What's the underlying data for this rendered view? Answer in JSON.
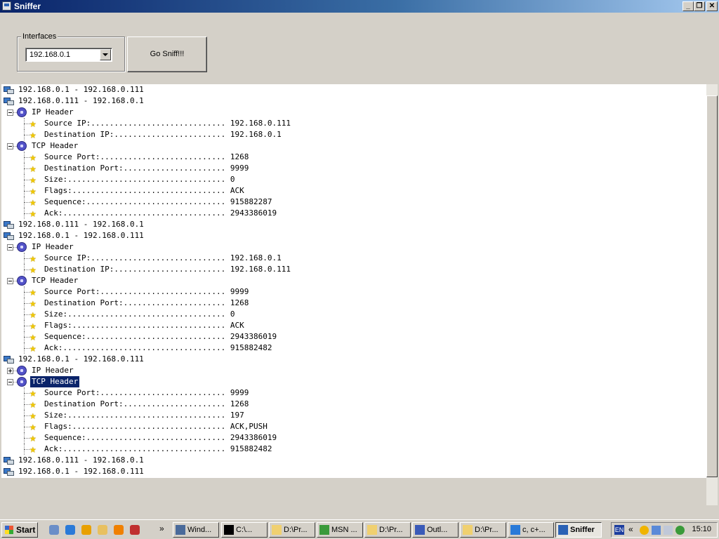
{
  "window": {
    "title": "Sniffer"
  },
  "interfaces": {
    "label": "Interfaces",
    "selected": "192.168.0.1"
  },
  "go_button": "Go Sniff!!!",
  "tree": [
    {
      "level": 0,
      "kind": "host",
      "text": "192.168.0.1 - 192.168.0.111"
    },
    {
      "level": 0,
      "kind": "host",
      "text": "192.168.0.111 - 192.168.0.1"
    },
    {
      "level": 1,
      "kind": "group",
      "exp": "minus",
      "text": "IP Header"
    },
    {
      "level": 2,
      "kind": "field",
      "text": "Source IP:............................. 192.168.0.111"
    },
    {
      "level": 2,
      "kind": "field",
      "text": "Destination IP:........................ 192.168.0.1"
    },
    {
      "level": 1,
      "kind": "group",
      "exp": "minus",
      "text": "TCP Header"
    },
    {
      "level": 2,
      "kind": "field",
      "text": "Source Port:........................... 1268"
    },
    {
      "level": 2,
      "kind": "field",
      "text": "Destination Port:...................... 9999"
    },
    {
      "level": 2,
      "kind": "field",
      "text": "Size:.................................. 0"
    },
    {
      "level": 2,
      "kind": "field",
      "text": "Flags:................................. ACK"
    },
    {
      "level": 2,
      "kind": "field",
      "text": "Sequence:.............................. 915882287"
    },
    {
      "level": 2,
      "kind": "field",
      "text": "Ack:................................... 2943386019"
    },
    {
      "level": 0,
      "kind": "host",
      "text": "192.168.0.111 - 192.168.0.1"
    },
    {
      "level": 0,
      "kind": "host",
      "text": "192.168.0.1 - 192.168.0.111"
    },
    {
      "level": 1,
      "kind": "group",
      "exp": "minus",
      "text": "IP Header"
    },
    {
      "level": 2,
      "kind": "field",
      "text": "Source IP:............................. 192.168.0.1"
    },
    {
      "level": 2,
      "kind": "field",
      "text": "Destination IP:........................ 192.168.0.111"
    },
    {
      "level": 1,
      "kind": "group",
      "exp": "minus",
      "text": "TCP Header"
    },
    {
      "level": 2,
      "kind": "field",
      "text": "Source Port:........................... 9999"
    },
    {
      "level": 2,
      "kind": "field",
      "text": "Destination Port:...................... 1268"
    },
    {
      "level": 2,
      "kind": "field",
      "text": "Size:.................................. 0"
    },
    {
      "level": 2,
      "kind": "field",
      "text": "Flags:................................. ACK"
    },
    {
      "level": 2,
      "kind": "field",
      "text": "Sequence:.............................. 2943386019"
    },
    {
      "level": 2,
      "kind": "field",
      "text": "Ack:................................... 915882482"
    },
    {
      "level": 0,
      "kind": "host",
      "text": "192.168.0.1 - 192.168.0.111"
    },
    {
      "level": 1,
      "kind": "group",
      "exp": "plus",
      "text": "IP Header"
    },
    {
      "level": 1,
      "kind": "group",
      "exp": "minus",
      "text": "TCP Header",
      "selected": true
    },
    {
      "level": 2,
      "kind": "field",
      "text": "Source Port:........................... 9999"
    },
    {
      "level": 2,
      "kind": "field",
      "text": "Destination Port:...................... 1268"
    },
    {
      "level": 2,
      "kind": "field",
      "text": "Size:.................................. 197"
    },
    {
      "level": 2,
      "kind": "field",
      "text": "Flags:................................. ACK,PUSH"
    },
    {
      "level": 2,
      "kind": "field",
      "text": "Sequence:.............................. 2943386019"
    },
    {
      "level": 2,
      "kind": "field",
      "text": "Ack:................................... 915882482"
    },
    {
      "level": 0,
      "kind": "host",
      "text": "192.168.0.111 - 192.168.0.1"
    },
    {
      "level": 0,
      "kind": "host",
      "text": "192.168.0.1 - 192.168.0.111"
    }
  ],
  "taskbar": {
    "start": "Start",
    "overflow": "»",
    "quicklaunch": [
      "show-desktop-icon",
      "ie-icon",
      "media-player-icon",
      "folder-icon",
      "clock-app-icon",
      "messenger-icon"
    ],
    "buttons": [
      {
        "label": "Wind...",
        "icon": "computer-icon"
      },
      {
        "label": "C:\\...",
        "icon": "cmd-icon"
      },
      {
        "label": "D:\\Pr...",
        "icon": "folder-icon"
      },
      {
        "label": "MSN ...",
        "icon": "msn-icon"
      },
      {
        "label": "D:\\Pr...",
        "icon": "folder-icon"
      },
      {
        "label": "Outl...",
        "icon": "outlook-icon"
      },
      {
        "label": "D:\\Pr...",
        "icon": "folder-icon"
      },
      {
        "label": "c, c+...",
        "icon": "browser-icon"
      },
      {
        "label": "Sniffer",
        "icon": "sniffer-icon",
        "active": true
      }
    ],
    "lang": "EN",
    "tray_chevron": "«",
    "clock": "15:10"
  }
}
